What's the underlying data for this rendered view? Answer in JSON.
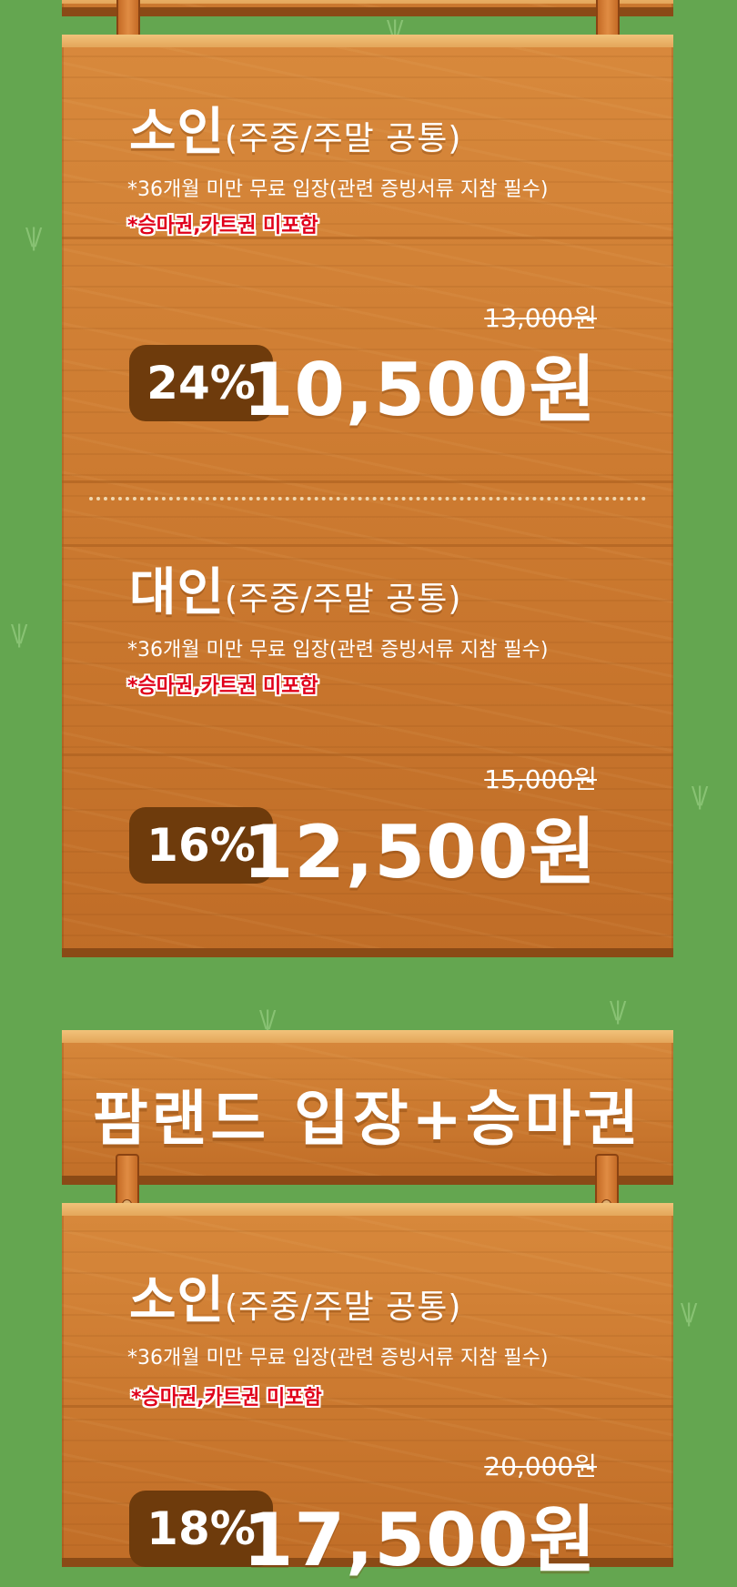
{
  "section1": {
    "child": {
      "title": "소인",
      "subtitle": "(주중/주말 공통)",
      "note": "*36개월 미만 무료 입장(관련 증빙서류 지참 필수)",
      "note_red": "*승마권,카트권 미포함",
      "original_price": "13,000원",
      "discount": "24%",
      "price": "10,500원"
    },
    "adult": {
      "title": "대인",
      "subtitle": "(주중/주말 공통)",
      "note": "*36개월 미만 무료 입장(관련 증빙서류 지참 필수)",
      "note_red": "*승마권,카트권 미포함",
      "original_price": "15,000원",
      "discount": "16%",
      "price": "12,500원"
    }
  },
  "section2": {
    "header": "팜랜드 입장+승마권",
    "child": {
      "title": "소인",
      "subtitle": "(주중/주말 공통)",
      "note": "*36개월 미만 무료 입장(관련 증빙서류 지참 필수)",
      "note_red": "*승마권,카트권 미포함",
      "original_price": "20,000원",
      "discount": "18%",
      "price": "17,500원"
    }
  }
}
